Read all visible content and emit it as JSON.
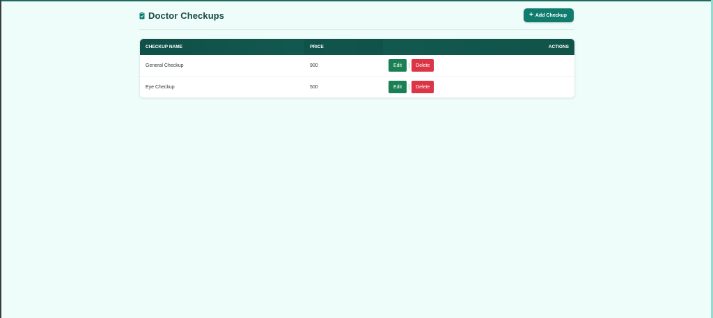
{
  "header": {
    "title": "Doctor Checkups",
    "add_label": "Add Checkup",
    "add_icon": "+"
  },
  "table": {
    "columns": [
      "CHECKUP NAME",
      "PRICE",
      "ACTIONS"
    ],
    "rows": [
      {
        "name": "General Checkup",
        "price": "900"
      },
      {
        "name": "Eye Checkup",
        "price": "500"
      }
    ],
    "edit_label": "Edit",
    "delete_label": "Delete"
  },
  "colors": {
    "accent": "#0f7c6e",
    "header_bg": "#135a51",
    "edit": "#1a7f54",
    "delete": "#dc3545",
    "background": "#eefcfa"
  },
  "icons": {
    "title": "clipboard-check-icon",
    "add": "plus-icon"
  }
}
